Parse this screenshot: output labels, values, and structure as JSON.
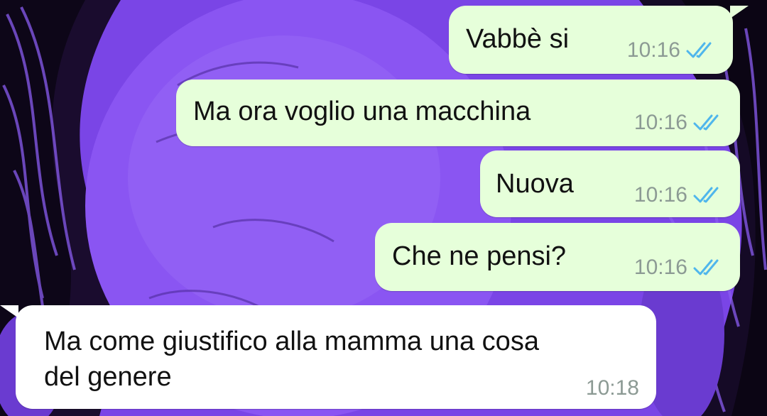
{
  "theme": {
    "wallpaper_color": "#7a45e6",
    "outgoing_bubble_color": "#e6ffda",
    "incoming_bubble_color": "#ffffff",
    "read_tick_color": "#4fb6ec",
    "time_color": "#8c9a94"
  },
  "messages": [
    {
      "direction": "outgoing",
      "text": "Vabbè si",
      "time": "10:16",
      "status_icon": "double-check-read-icon"
    },
    {
      "direction": "outgoing",
      "text": "Ma ora voglio una macchina",
      "time": "10:16",
      "status_icon": "double-check-read-icon"
    },
    {
      "direction": "outgoing",
      "text": "Nuova",
      "time": "10:16",
      "status_icon": "double-check-read-icon"
    },
    {
      "direction": "outgoing",
      "text": "Che ne pensi?",
      "time": "10:16",
      "status_icon": "double-check-read-icon"
    },
    {
      "direction": "incoming",
      "lines": [
        "Ma come giustifico alla mamma una cosa",
        "del genere"
      ],
      "time": "10:18"
    }
  ]
}
